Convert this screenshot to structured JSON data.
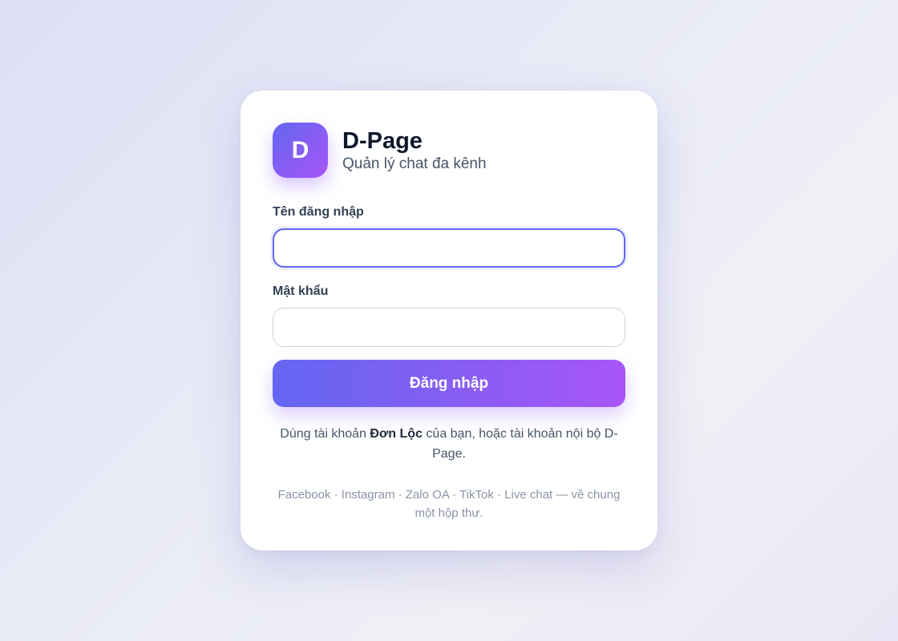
{
  "brand": {
    "logo_letter": "D",
    "name": "D-Page",
    "tagline": "Quản lý chat đa kênh"
  },
  "form": {
    "username_label": "Tên đăng nhập",
    "username_value": "",
    "username_placeholder": "",
    "password_label": "Mật khẩu",
    "password_value": "",
    "password_placeholder": "",
    "submit_label": "Đăng nhập"
  },
  "note": {
    "prefix": "Dùng tài khoản ",
    "highlight": "Đơn Lộc",
    "suffix": " của bạn, hoặc tài khoản nội bộ D-Page."
  },
  "channels_text": "Facebook · Instagram · Zalo OA · TikTok · Live chat — về chung một hộp thư.",
  "colors": {
    "accent_start": "#6366f1",
    "accent_end": "#a855f7",
    "focus_border": "#6366f1",
    "text_dark": "#0f172a"
  }
}
